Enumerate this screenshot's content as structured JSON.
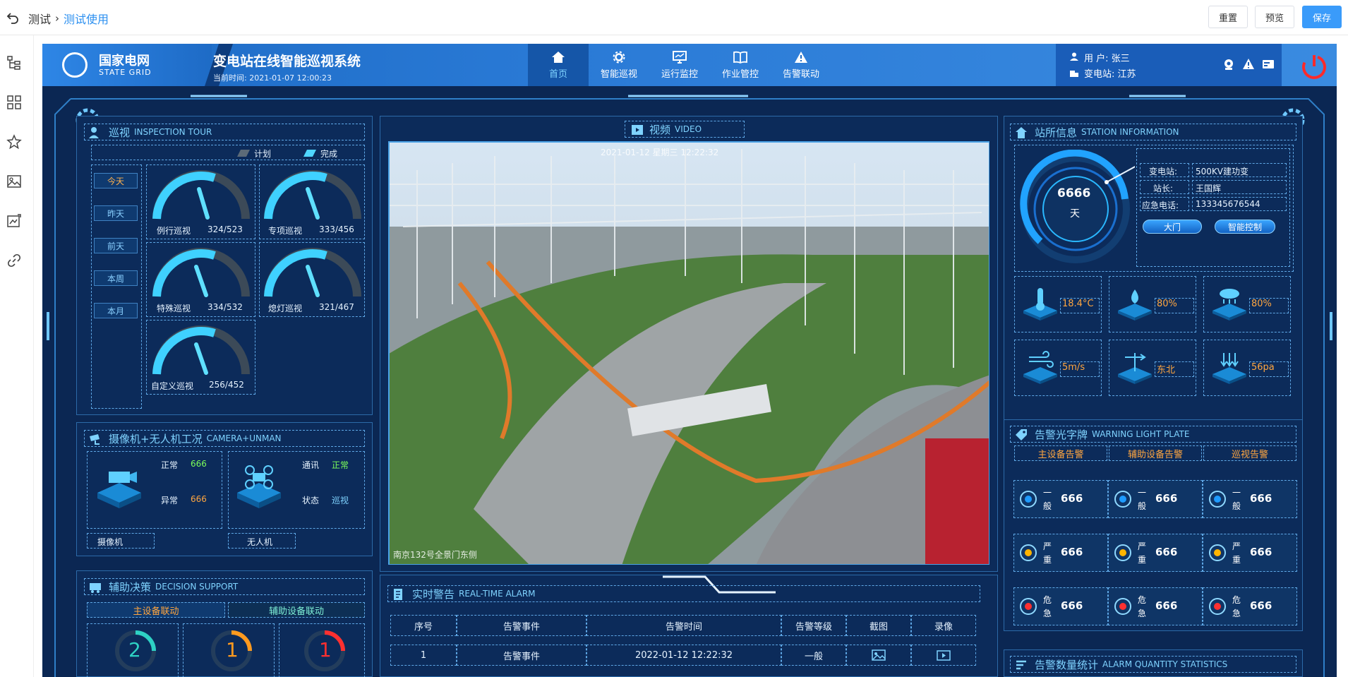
{
  "topbar": {
    "crumb_root": "测试",
    "crumb_sep": "›",
    "crumb_current": "测试使用",
    "reset_label": "重置",
    "preview_label": "预览",
    "save_label": "保存"
  },
  "header": {
    "logo_cn": "国家电网",
    "logo_en": "STATE GRID",
    "title": "变电站在线智能巡视系统",
    "time_label": "当前时间:",
    "time_value": "2021-01-07  12:00:23",
    "nav": [
      {
        "label": "首页",
        "icon": "home-icon"
      },
      {
        "label": "智能巡视",
        "icon": "gear-icon"
      },
      {
        "label": "运行监控",
        "icon": "monitor-icon"
      },
      {
        "label": "作业管控",
        "icon": "book-icon"
      },
      {
        "label": "告警联动",
        "icon": "warning-icon"
      }
    ],
    "user_label": "用    户:",
    "user_value": "张三",
    "station_label": "变电站:",
    "station_value": "江苏"
  },
  "inspection": {
    "title": "巡视",
    "title_en": "INSPECTION TOUR",
    "legend_plan": "计划",
    "legend_done": "完成",
    "days": [
      "今天",
      "昨天",
      "前天",
      "本周",
      "本月"
    ],
    "gauges": [
      {
        "name": "例行巡视",
        "value": "324/523"
      },
      {
        "name": "专项巡视",
        "value": "333/456"
      },
      {
        "name": "特殊巡视",
        "value": "334/532"
      },
      {
        "name": "熄灯巡视",
        "value": "321/467"
      },
      {
        "name": "自定义巡视",
        "value": "256/452"
      }
    ]
  },
  "camera": {
    "title": "摄像机+无人机工况",
    "title_en": "CAMERA+UNMAN",
    "cam_normal_label": "正常",
    "cam_normal_value": "666",
    "cam_abnormal_label": "异常",
    "cam_abnormal_value": "666",
    "cam_name": "摄像机",
    "uav_comm_label": "通讯",
    "uav_comm_value": "正常",
    "uav_state_label": "状态",
    "uav_state_value": "巡视",
    "uav_name": "无人机"
  },
  "decision": {
    "title": "辅助决策",
    "title_en": "DECISION SUPPORT",
    "btn_main": "主设备联动",
    "btn_aux": "辅助设备联动",
    "rings": [
      "2",
      "1",
      "1"
    ]
  },
  "video": {
    "title": "视频",
    "title_en": "VIDEO",
    "overlay_top": "2021-01-12  星期三  12:22:32",
    "overlay_bottom": "南京132号全景门东侧"
  },
  "alarm": {
    "title": "实时警告",
    "title_en": "REAL-TIME ALARM",
    "columns": [
      "序号",
      "告警事件",
      "告警时间",
      "告警等级",
      "截图",
      "录像"
    ],
    "rows": [
      {
        "no": "1",
        "event": "告警事件",
        "time": "2022-01-12 12:22:32",
        "level": "一般"
      }
    ]
  },
  "station": {
    "title": "站所信息",
    "title_en": "STATION INFORMATION",
    "days_value": "6666",
    "days_unit": "天",
    "station_label": "变电站:",
    "station_value": "500KV建功变",
    "master_label": "站长:",
    "master_value": "王国辉",
    "phone_label": "应急电话:",
    "phone_value": "133345676544",
    "btn_gate": "大门",
    "btn_smart": "智能控制",
    "env": [
      {
        "icon": "thermometer-icon",
        "value": "18.4°C"
      },
      {
        "icon": "humidity-icon",
        "value": "80%"
      },
      {
        "icon": "rain-icon",
        "value": "80%"
      },
      {
        "icon": "wind-speed-icon",
        "value": "5m/s"
      },
      {
        "icon": "wind-direction-icon",
        "value": "东北"
      },
      {
        "icon": "pressure-icon",
        "value": "56pa"
      }
    ]
  },
  "warning": {
    "title": "告警光字牌",
    "title_en": "WARNING LIGHT PLATE",
    "cols": [
      "主设备告警",
      "辅助设备告警",
      "巡视告警"
    ],
    "levels": [
      {
        "label": "一般",
        "value": "666",
        "color": "#1e9bff"
      },
      {
        "label": "严重",
        "value": "666",
        "color": "#ffb400"
      },
      {
        "label": "危急",
        "value": "666",
        "color": "#ff3030"
      }
    ]
  },
  "stats": {
    "title": "告警数量统计",
    "title_en": "ALARM QUANTITY STATISTICS"
  }
}
